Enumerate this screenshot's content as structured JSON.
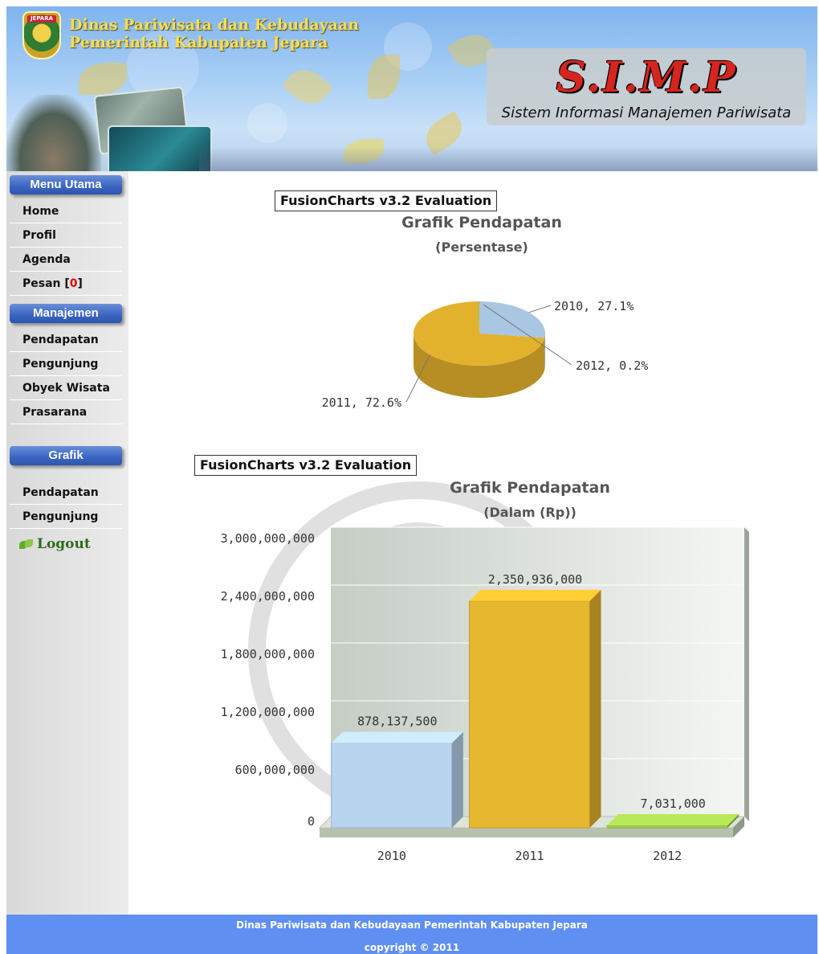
{
  "header": {
    "agency_line1": "Dinas Pariwisata dan Kebudayaan",
    "agency_line2": "Pemerintah Kabupaten Jepara",
    "logo_text": "JEPARA",
    "app_title": "S.I.M.P",
    "app_subtitle": "Sistem Informasi Manajemen Pariwisata"
  },
  "sidebar": {
    "section_main": "Menu Utama",
    "main_items": [
      {
        "label": "Home"
      },
      {
        "label": "Profil"
      },
      {
        "label": "Agenda"
      },
      {
        "label": "Pesan ",
        "badge": "0"
      }
    ],
    "section_manage": "Manajemen",
    "manage_items": [
      {
        "label": "Pendapatan"
      },
      {
        "label": "Pengunjung"
      },
      {
        "label": "Obyek Wisata"
      },
      {
        "label": "Prasarana"
      }
    ],
    "section_chart": "Grafik",
    "chart_items": [
      {
        "label": "Pendapatan"
      },
      {
        "label": "Pengunjung"
      }
    ],
    "logout": "Logout"
  },
  "charts": {
    "pie_eval": "FusionCharts v3.2 Evaluation",
    "bar_eval": "FusionCharts v3.2 Evaluation"
  },
  "chart_data": [
    {
      "type": "pie",
      "title": "Grafik Pendapatan",
      "subtitle": "(Persentase)",
      "slices": [
        {
          "label": "2010",
          "value": 27.1,
          "text": "2010, 27.1%",
          "color": "#a9c6e3"
        },
        {
          "label": "2011",
          "value": 72.6,
          "text": "2011, 72.6%",
          "color": "#e3b22c"
        },
        {
          "label": "2012",
          "value": 0.2,
          "text": "2012, 0.2%",
          "color": "#8cbf3f"
        }
      ]
    },
    {
      "type": "bar",
      "title": "Grafik Pendapatan",
      "subtitle": "(Dalam (Rp))",
      "categories": [
        "2010",
        "2011",
        "2012"
      ],
      "values": [
        878137500,
        2350936000,
        7031000
      ],
      "value_labels": [
        "878,137,500",
        "2,350,936,000",
        "7,031,000"
      ],
      "colors": [
        "#b9d4ee",
        "#e6b82f",
        "#a5cf4f"
      ],
      "ylim": [
        0,
        3000000000
      ],
      "yticks": [
        "0",
        "600,000,000",
        "1,200,000,000",
        "1,800,000,000",
        "2,400,000,000",
        "3,000,000,000"
      ],
      "grid": true
    }
  ],
  "footer": {
    "line1": "Dinas Pariwisata dan Kebudayaan Pemerintah Kabupaten Jepara",
    "line2": "copyright © 2011"
  }
}
